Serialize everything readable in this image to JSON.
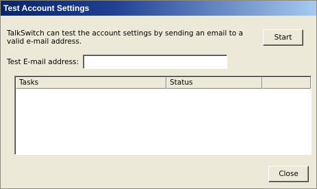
{
  "window": {
    "title": "Test Account Settings"
  },
  "description": "TalkSwitch can test the account settings by sending an email to a valid e-mail address.",
  "buttons": {
    "start_label": "Start",
    "close_label": "Close"
  },
  "email": {
    "label": "Test E-mail address:",
    "value": "",
    "placeholder": ""
  },
  "task_list": {
    "columns": [
      "Tasks",
      "Status"
    ],
    "rows": []
  },
  "colors": {
    "titlebar_start": "#0a246a",
    "titlebar_end": "#a6caf0",
    "dialog_background": "#ece9d8"
  }
}
